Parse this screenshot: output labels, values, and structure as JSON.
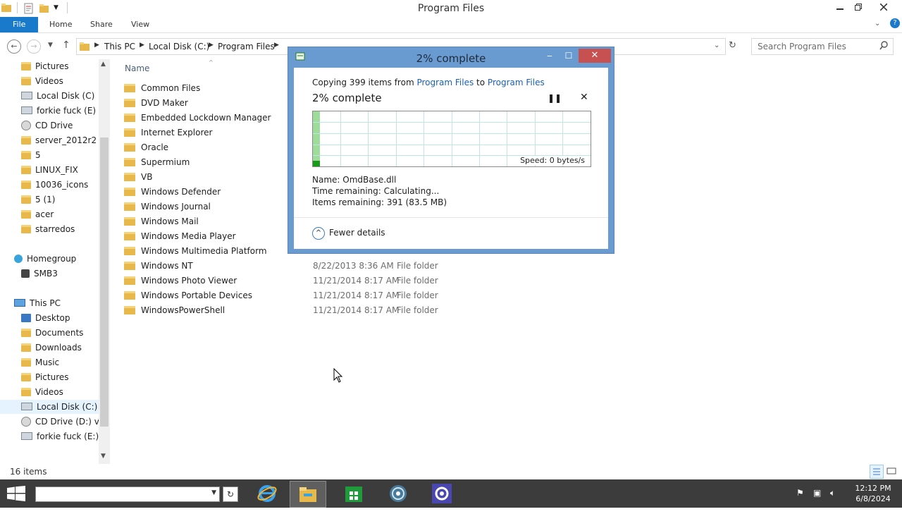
{
  "window": {
    "title": "Program Files",
    "minimize_icon": "minimize-icon",
    "maximize_icon": "restore-icon",
    "close_icon": "close-icon"
  },
  "ribbon": {
    "tabs": [
      {
        "label": "File"
      },
      {
        "label": "Home"
      },
      {
        "label": "Share"
      },
      {
        "label": "View"
      }
    ]
  },
  "address": {
    "crumbs": [
      "This PC",
      "Local Disk (C:)",
      "Program Files"
    ]
  },
  "search": {
    "placeholder": "Search Program Files"
  },
  "navpane": {
    "items": [
      {
        "label": "Pictures",
        "icon": "folder-icon"
      },
      {
        "label": "Videos",
        "icon": "folder-icon"
      },
      {
        "label": "Local Disk (C)",
        "icon": "drive-icon"
      },
      {
        "label": "forkie fuck (E)",
        "icon": "drive-icon"
      },
      {
        "label": "CD Drive",
        "icon": "cd-drive-icon"
      },
      {
        "label": "server_2012r2",
        "icon": "folder-icon"
      },
      {
        "label": "5",
        "icon": "folder-icon"
      },
      {
        "label": "LINUX_FIX",
        "icon": "folder-icon"
      },
      {
        "label": "10036_icons",
        "icon": "folder-icon"
      },
      {
        "label": "5 (1)",
        "icon": "folder-icon"
      },
      {
        "label": "acer",
        "icon": "folder-icon"
      },
      {
        "label": "starredos",
        "icon": "folder-icon"
      }
    ],
    "homegroup": {
      "label": "Homegroup",
      "child": "SMB3"
    },
    "thispc": {
      "label": "This PC",
      "items": [
        {
          "label": "Desktop",
          "icon": "folder-icon"
        },
        {
          "label": "Documents",
          "icon": "folder-icon"
        },
        {
          "label": "Downloads",
          "icon": "folder-icon"
        },
        {
          "label": "Music",
          "icon": "folder-icon"
        },
        {
          "label": "Pictures",
          "icon": "folder-icon"
        },
        {
          "label": "Videos",
          "icon": "folder-icon"
        },
        {
          "label": "Local Disk (C:)",
          "icon": "drive-icon"
        },
        {
          "label": "CD Drive (D:) virt",
          "icon": "cd-drive-icon"
        },
        {
          "label": "forkie fuck (E:)",
          "icon": "drive-icon"
        }
      ]
    }
  },
  "filelist": {
    "column_name": "Name",
    "rows": [
      {
        "name": "Common Files",
        "date": "",
        "type": ""
      },
      {
        "name": "DVD Maker",
        "date": "",
        "type": ""
      },
      {
        "name": "Embedded Lockdown Manager",
        "date": "",
        "type": ""
      },
      {
        "name": "Internet Explorer",
        "date": "",
        "type": ""
      },
      {
        "name": "Oracle",
        "date": "",
        "type": ""
      },
      {
        "name": "Supermium",
        "date": "",
        "type": ""
      },
      {
        "name": "VB",
        "date": "",
        "type": ""
      },
      {
        "name": "Windows Defender",
        "date": "",
        "type": ""
      },
      {
        "name": "Windows Journal",
        "date": "",
        "type": ""
      },
      {
        "name": "Windows Mail",
        "date": "",
        "type": ""
      },
      {
        "name": "Windows Media Player",
        "date": "",
        "type": ""
      },
      {
        "name": "Windows Multimedia Platform",
        "date": "",
        "type": ""
      },
      {
        "name": "Windows NT",
        "date": "8/22/2013 8:36 AM",
        "type": "File folder"
      },
      {
        "name": "Windows Photo Viewer",
        "date": "11/21/2014 8:17 AM",
        "type": "File folder"
      },
      {
        "name": "Windows Portable Devices",
        "date": "11/21/2014 8:17 AM",
        "type": "File folder"
      },
      {
        "name": "WindowsPowerShell",
        "date": "11/21/2014 8:17 AM",
        "type": "File folder"
      }
    ]
  },
  "status": {
    "item_count": "16 items"
  },
  "copy_dialog": {
    "title": "2% complete",
    "copying_prefix": "Copying 399 items from ",
    "source": "Program Files",
    "to_word": " to ",
    "destination": "Program Files",
    "heading": "2% complete",
    "progress_percent": 2,
    "speed": "Speed: 0 bytes/s",
    "name_line": "Name:  OmdBase.dll",
    "time_line": "Time remaining:  Calculating...",
    "items_line": "Items remaining:  391 (83.5 MB)",
    "fewer_details": "Fewer details",
    "pause_icon": "pause-icon",
    "cancel_icon": "cancel-icon"
  },
  "taskbar": {
    "clock_time": "12:12 PM",
    "clock_date": "6/8/2024",
    "apps": [
      "internet-explorer-icon",
      "file-explorer-icon",
      "store-icon",
      "network-icon",
      "settings-icon"
    ]
  },
  "colors": {
    "accent": "#1979ca",
    "dialog_frame": "#6a9bd0",
    "close_red": "#c75050",
    "progress_green": "#1a9a1a",
    "taskbar": "#3c3c3c"
  }
}
